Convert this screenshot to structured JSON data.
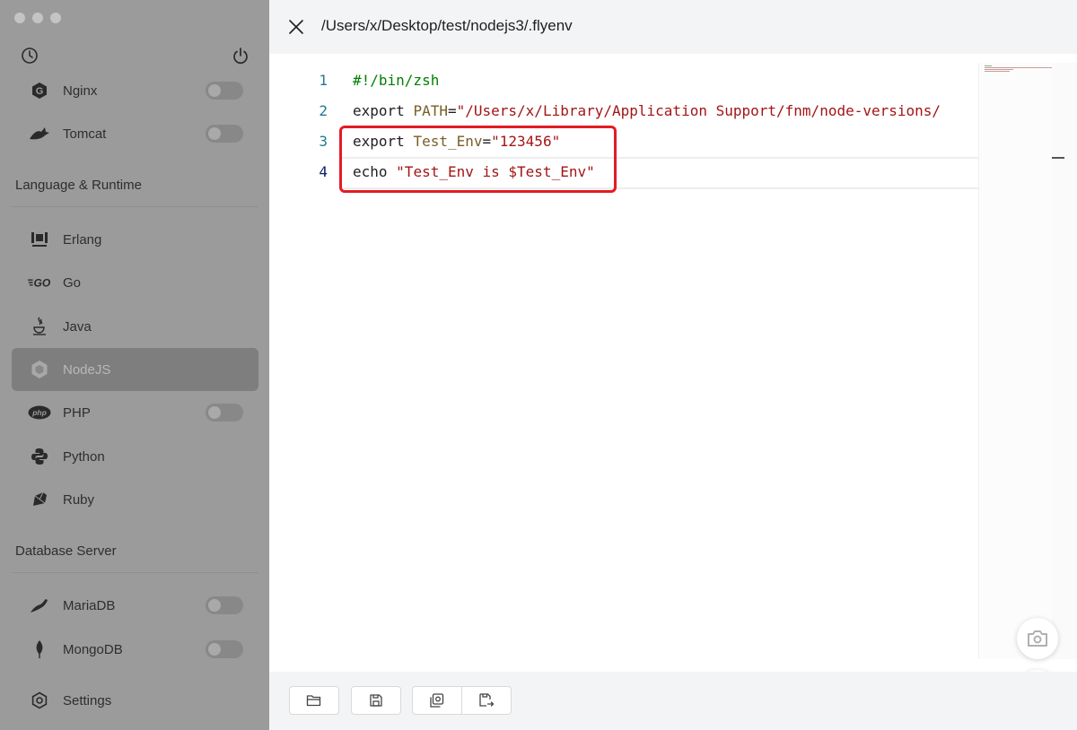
{
  "window": {
    "traffic_lights": [
      "close",
      "minimize",
      "zoom"
    ]
  },
  "sidebar": {
    "top_icons": {
      "left": "clock-icon",
      "right": "power-icon"
    },
    "items_top": [
      {
        "label": "Nginx",
        "icon": "nginx-icon",
        "toggle": "off"
      },
      {
        "label": "Tomcat",
        "icon": "tomcat-icon",
        "toggle": "off"
      }
    ],
    "groups": [
      {
        "title": "Language & Runtime",
        "items": [
          {
            "label": "Erlang",
            "icon": "erlang-icon"
          },
          {
            "label": "Go",
            "icon": "go-icon"
          },
          {
            "label": "Java",
            "icon": "java-icon"
          },
          {
            "label": "NodeJS",
            "icon": "nodejs-icon",
            "active": true
          },
          {
            "label": "PHP",
            "icon": "php-icon",
            "toggle": "off"
          },
          {
            "label": "Python",
            "icon": "python-icon"
          },
          {
            "label": "Ruby",
            "icon": "ruby-icon"
          }
        ]
      },
      {
        "title": "Database Server",
        "items": [
          {
            "label": "MariaDB",
            "icon": "mariadb-icon",
            "toggle": "off"
          },
          {
            "label": "MongoDB",
            "icon": "mongodb-icon",
            "toggle": "off"
          }
        ]
      }
    ],
    "settings": {
      "label": "Settings",
      "icon": "gear-icon"
    }
  },
  "drawer": {
    "title": "/Users/x/Desktop/test/nodejs3/.flyenv",
    "close_icon": "close-icon",
    "editor": {
      "current_line": 4,
      "lines": [
        {
          "number": "1",
          "tokens": [
            {
              "t": "#!/bin/zsh",
              "k": "comment"
            }
          ]
        },
        {
          "number": "2",
          "tokens": [
            {
              "t": "export ",
              "k": "plain"
            },
            {
              "t": "PATH",
              "k": "var"
            },
            {
              "t": "=",
              "k": "plain"
            },
            {
              "t": "\"/Users/x/Library/Application Support/fnm/node-versions/",
              "k": "str"
            }
          ]
        },
        {
          "number": "3",
          "tokens": [
            {
              "t": "export ",
              "k": "plain"
            },
            {
              "t": "Test_Env",
              "k": "var"
            },
            {
              "t": "=",
              "k": "plain"
            },
            {
              "t": "\"123456\"",
              "k": "str"
            }
          ]
        },
        {
          "number": "4",
          "tokens": [
            {
              "t": "echo ",
              "k": "plain"
            },
            {
              "t": "\"Test_Env is $Test_Env\"",
              "k": "str"
            }
          ]
        }
      ],
      "highlighted_lines": [
        3,
        4
      ],
      "highlight_color": "#e31c23"
    },
    "floating_buttons": [
      "camera-icon",
      "robot-icon"
    ],
    "footer_buttons": [
      "open-folder-icon",
      "save-icon",
      "open-in-file-icon",
      "save-as-icon"
    ]
  }
}
